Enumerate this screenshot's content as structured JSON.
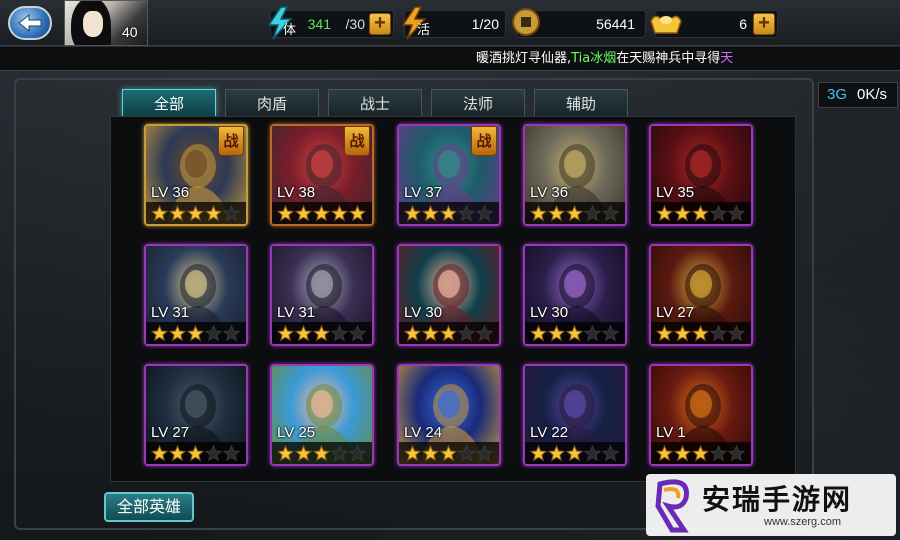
{
  "player": {
    "level": "40"
  },
  "resources": {
    "stamina": {
      "label": "体",
      "current": "341",
      "max": "/30"
    },
    "vitality": {
      "label": "活",
      "value": "1/20"
    },
    "coins": {
      "value": "56441"
    },
    "gold": {
      "value": "6"
    }
  },
  "ticker": {
    "part1": "暖酒挑灯寻仙器,",
    "player_name": "Tia冰烟",
    "part2": "在天赐神兵中寻得",
    "item": "天"
  },
  "network": {
    "type": "3G",
    "speed": "0K/s"
  },
  "tabs": [
    {
      "label": "全部",
      "active": true
    },
    {
      "label": "肉盾",
      "active": false
    },
    {
      "label": "战士",
      "active": false
    },
    {
      "label": "法师",
      "active": false
    },
    {
      "label": "辅助",
      "active": false
    }
  ],
  "war_badge_label": "战",
  "heroes": [
    {
      "level": "LV 36",
      "stars": 4,
      "frame": "gold",
      "war": true,
      "palette": [
        "#2c3a55",
        "#6d4b2a",
        "#c89a3a"
      ]
    },
    {
      "level": "LV 38",
      "stars": 5,
      "frame": "orange",
      "war": true,
      "palette": [
        "#7a1e2a",
        "#d04040",
        "#3a2630"
      ]
    },
    {
      "level": "LV 37",
      "stars": 3,
      "frame": "purple",
      "war": true,
      "palette": [
        "#1e5a6a",
        "#2f8f8a",
        "#6a3a8a"
      ]
    },
    {
      "level": "LV 36",
      "stars": 3,
      "frame": "purple",
      "war": false,
      "palette": [
        "#6d6a5c",
        "#c8b068",
        "#3b3428"
      ]
    },
    {
      "level": "LV 35",
      "stars": 3,
      "frame": "purple",
      "war": false,
      "palette": [
        "#5a0f14",
        "#b02828",
        "#1e0a0c"
      ]
    },
    {
      "level": "LV 31",
      "stars": 3,
      "frame": "purple",
      "war": false,
      "palette": [
        "#2a3a5a",
        "#d8c88a",
        "#1a1f2e"
      ]
    },
    {
      "level": "LV 31",
      "stars": 3,
      "frame": "purple",
      "war": false,
      "palette": [
        "#3a2f55",
        "#a8a8b8",
        "#1a1524"
      ]
    },
    {
      "level": "LV 30",
      "stars": 3,
      "frame": "purple",
      "war": false,
      "palette": [
        "#0f3f4a",
        "#e8b8a0",
        "#6a1a24"
      ]
    },
    {
      "level": "LV 30",
      "stars": 3,
      "frame": "purple",
      "war": false,
      "palette": [
        "#2a1f4a",
        "#9a6acf",
        "#120d22"
      ]
    },
    {
      "level": "LV 27",
      "stars": 3,
      "frame": "purple",
      "war": false,
      "palette": [
        "#5a1a10",
        "#d8a838",
        "#2a0c08"
      ]
    },
    {
      "level": "LV 27",
      "stars": 3,
      "frame": "purple",
      "war": false,
      "palette": [
        "#1e2e3e",
        "#4a5a6a",
        "#0c1218"
      ]
    },
    {
      "level": "LV 25",
      "stars": 3,
      "frame": "purple",
      "war": false,
      "palette": [
        "#3a9ad8",
        "#f0b8a0",
        "#6a8a3a"
      ]
    },
    {
      "level": "LV 24",
      "stars": 3,
      "frame": "purple",
      "war": false,
      "palette": [
        "#1a2a7a",
        "#3a6ad8",
        "#c89a3a"
      ]
    },
    {
      "level": "LV 22",
      "stars": 3,
      "frame": "purple",
      "war": false,
      "palette": [
        "#142044",
        "#5a4aa8",
        "#2a1a3a"
      ]
    },
    {
      "level": "LV 1",
      "stars": 3,
      "frame": "purple",
      "war": false,
      "palette": [
        "#6a1a10",
        "#d8701a",
        "#2a0a06"
      ]
    }
  ],
  "all_heroes_button": "全部英雄",
  "watermark": {
    "title": "安瑞手游网",
    "url": "www.szerg.com"
  }
}
